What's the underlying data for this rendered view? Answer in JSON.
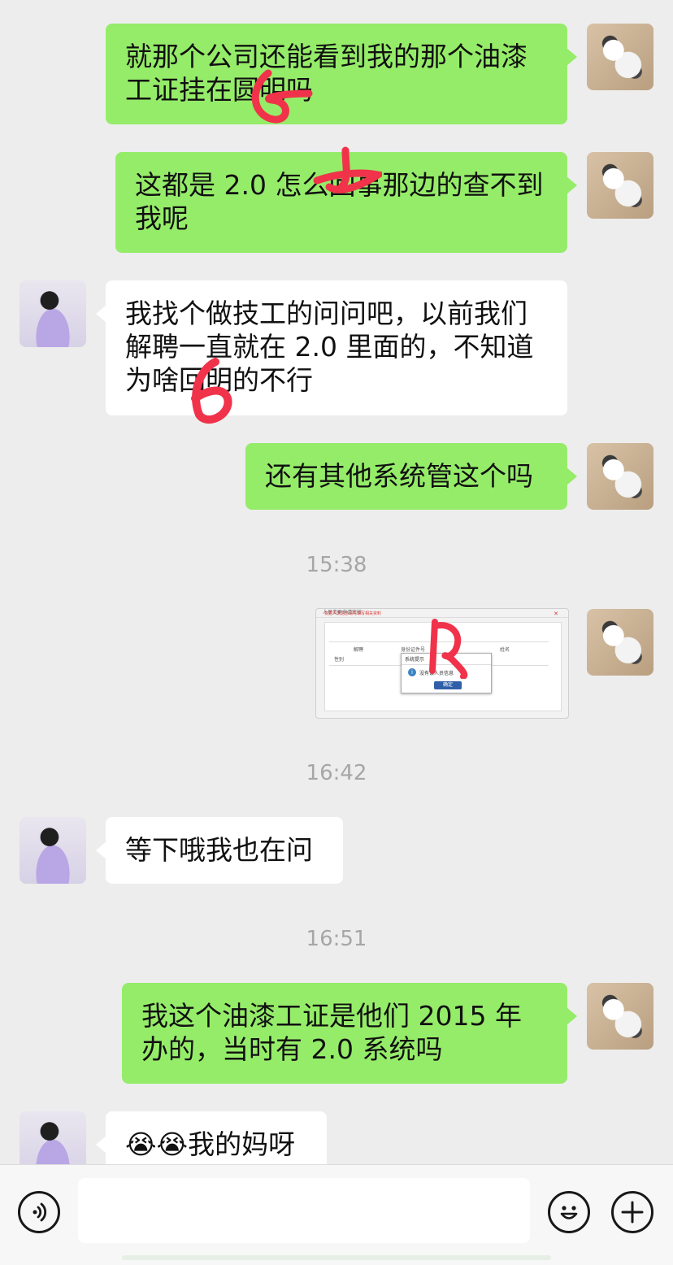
{
  "messages": [
    {
      "id": "m1",
      "side": "me",
      "text": "就那个公司还能看到我的那个油漆工证挂在圆明吗"
    },
    {
      "id": "m2",
      "side": "me",
      "text": "这都是 2.0 怎么回事那边的查不到我呢"
    },
    {
      "id": "m3",
      "side": "them",
      "text": "我找个做技工的问问吧，以前我们解聘一直就在 2.0 里面的，不知道为啥回明的不行"
    },
    {
      "id": "m4",
      "side": "me",
      "text": "还有其他系统管这个吗"
    },
    {
      "id": "t1",
      "type": "time",
      "text": "15:38"
    },
    {
      "id": "img1",
      "side": "me",
      "type": "image",
      "image": {
        "window_title": "人员变更申请审核",
        "top_notice": "变更人员信息请先填写相关资料",
        "fields": [
          "解聘",
          "身份证件号",
          "姓名",
          "性别"
        ],
        "dialog_title": "系统提示",
        "dialog_message": "没有该人员信息",
        "dialog_button": "确定"
      }
    },
    {
      "id": "t2",
      "type": "time",
      "text": "16:42"
    },
    {
      "id": "m5",
      "side": "them",
      "text": "等下哦我也在问"
    },
    {
      "id": "t3",
      "type": "time",
      "text": "16:51"
    },
    {
      "id": "m6",
      "side": "me",
      "text": "我这个油漆工证是他们 2015 年办的，当时有 2.0 系统吗"
    },
    {
      "id": "m7",
      "side": "them",
      "text": "😭😭我的妈呀"
    }
  ],
  "input_bar": {
    "voice_icon": "voice-icon",
    "emoji_icon": "emoji-icon",
    "plus_icon": "plus-icon",
    "input_value": ""
  },
  "colors": {
    "me_bubble": "#95ec69",
    "them_bubble": "#ffffff",
    "background": "#ededed",
    "timestamp": "#a6a6a6",
    "scribble": "#f0334a"
  }
}
